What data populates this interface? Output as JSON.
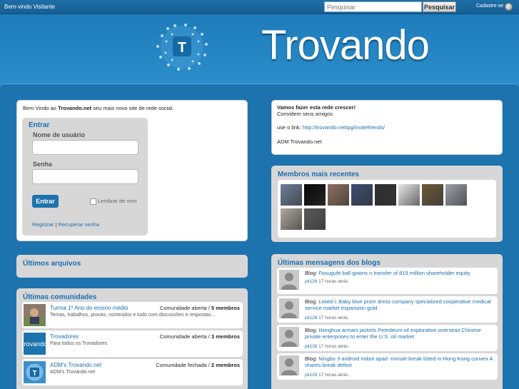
{
  "topbar": {
    "welcome": "Bem-vindo Visitante",
    "search_placeholder": "Pesquisar",
    "search_button": "Pesquisar",
    "signup": "Cadastre-se"
  },
  "header": {
    "brand": "Trovando"
  },
  "welcome_box": {
    "prefix": "Bem Vindo ao ",
    "site": "Trovando.net",
    "suffix": " seu mais novo site de rede social."
  },
  "login": {
    "title": "Entrar",
    "username_label": "Nome de usuário",
    "password_label": "Senha",
    "submit": "Entrar",
    "remember": "Lembrar de mim",
    "register": "Registrar",
    "separator": " | ",
    "recover": "Recuperar senha"
  },
  "files": {
    "title": "Últimos arquivos"
  },
  "communities": {
    "title": "Últimas comunidades",
    "items": [
      {
        "name": "Turma 1º Ano do ensino médio",
        "desc": "Temas, trabalhos, provas, conteúdos e tudo com discussões e respostas...",
        "status": "Comunidade aberta",
        "count": "5 membros"
      },
      {
        "name": "Trovadores",
        "desc": "Para todos os Trovadores",
        "status": "Comunidade aberta",
        "count": "3 membros"
      },
      {
        "name": "ADM's Trovando.net",
        "desc": "ADM's Trovando.net",
        "status": "Comunidade fechada",
        "count": "2 membros"
      }
    ]
  },
  "invite": {
    "title": "Vamos fazer esta rede crescer!",
    "line2": "Convidem seus amigos",
    "link_label": "use o link:",
    "link": "http://trovando.net/pg/invitefriends/",
    "signature": "ADM Trovando.net"
  },
  "members": {
    "title": "Membros mais recentes",
    "colors": [
      "#6a7f9a",
      "#050505",
      "#8f7060",
      "#3c4b70",
      "#2f2f2f",
      "#e8e8e8",
      "#6b5a3a",
      "#9aa0a8",
      "#b0a8a0",
      "#5a5a5a"
    ]
  },
  "blogs": {
    "title": "Últimas mensagens dos blogs",
    "prefix": "Blog:",
    "items": [
      {
        "text": "Fosugufe ball gowns n transfer of 819 million shareholder equity",
        "user": "pii128",
        "time": "17 horas atrás"
      },
      {
        "text": "Listed c Baby blue prom dress company specialized cooperative medical service market expansion gold",
        "user": "pii128",
        "time": "17 horas atrás"
      },
      {
        "text": "Honghua armani jackets Petroleum oil exploration overseas Chinese private enterprises to enter the U.S. oil market",
        "user": "pii128",
        "time": "17 horas atrás"
      },
      {
        "text": "Ningbo 3 android irobot apad -minute break listed in Hong Kong convex A shares break defect",
        "user": "pii128",
        "time": "17 horas atrás"
      }
    ]
  }
}
